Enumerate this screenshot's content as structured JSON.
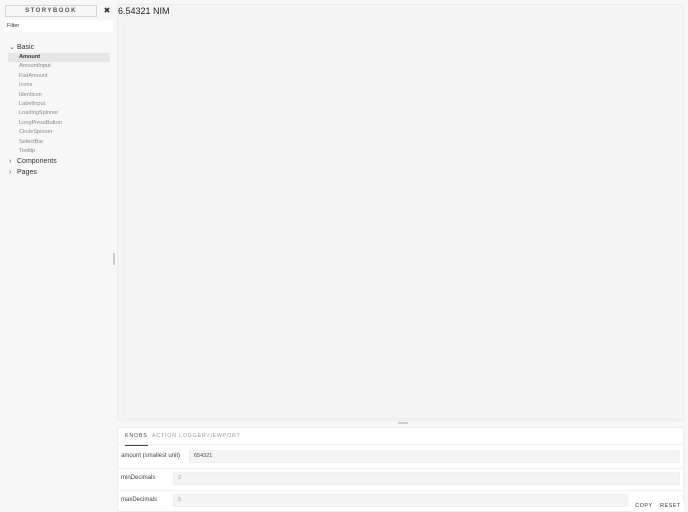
{
  "sidebar": {
    "brand": "STORYBOOK",
    "shortcuts_icon": "close-icon",
    "filter_placeholder": "Filter",
    "groups": [
      {
        "label": "Basic",
        "expanded": true,
        "items": [
          {
            "label": "Amount",
            "selected": true
          },
          {
            "label": "AmountInput"
          },
          {
            "label": "FiatAmount"
          },
          {
            "label": "Icons"
          },
          {
            "label": "Identicon"
          },
          {
            "label": "LabelInput"
          },
          {
            "label": "LoadingSpinner"
          },
          {
            "label": "LongPressButton"
          },
          {
            "label": "CircleSpinner"
          },
          {
            "label": "SelectBar"
          },
          {
            "label": "Tooltip"
          }
        ]
      },
      {
        "label": "Components",
        "expanded": false
      },
      {
        "label": "Pages",
        "expanded": false
      }
    ]
  },
  "preview": {
    "amount_display": "6.54321 NIM"
  },
  "panel": {
    "tabs": [
      {
        "label": "KNOBS",
        "active": true
      },
      {
        "label": "ACTION LOGGER"
      },
      {
        "label": "VIEWPORT"
      }
    ],
    "knobs": [
      {
        "label": "amount (smallest unit)",
        "value": "654321"
      },
      {
        "label": "minDecimals",
        "value": "2"
      },
      {
        "label": "maxDecimals",
        "value": "5"
      }
    ],
    "copy_label": "COPY",
    "reset_label": "RESET"
  }
}
